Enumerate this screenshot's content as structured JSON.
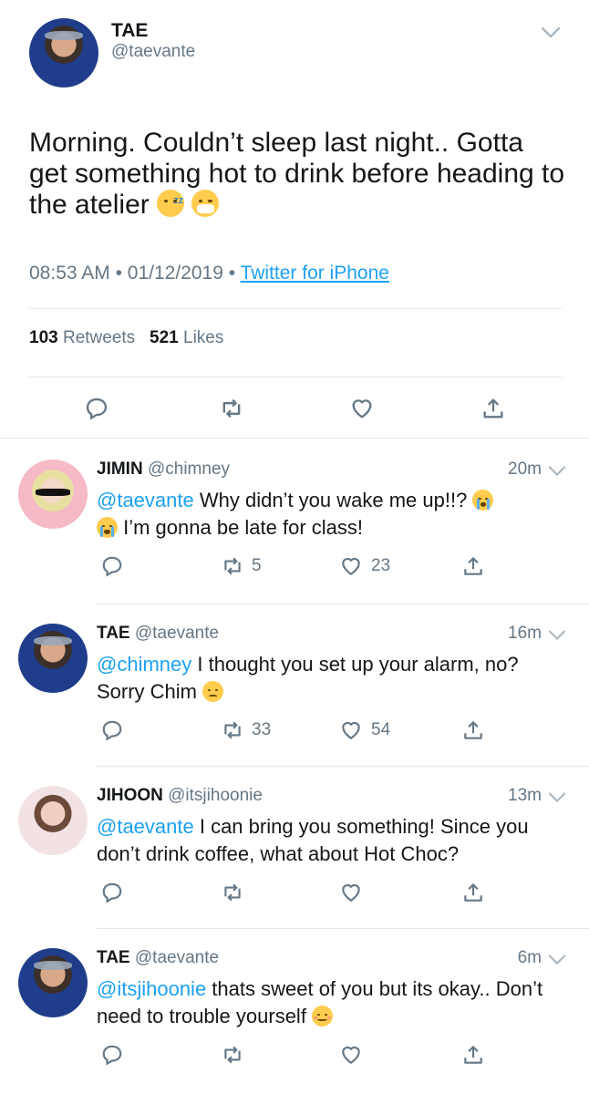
{
  "main_tweet": {
    "name": "TAE",
    "handle": "@taevante",
    "text": "Morning. Couldn’t sleep last night.. Gotta get something hot to drink before heading to the atelier",
    "emojis": [
      "sleeping-face-emoji",
      "mask-face-emoji"
    ],
    "time": "08:53 AM",
    "separator": "•",
    "date": "01/12/2019",
    "source": "Twitter for iPhone",
    "retweets_count": "103",
    "retweets_label": "Retweets",
    "likes_count": "521",
    "likes_label": "Likes"
  },
  "replies": [
    {
      "name": "JIMIN",
      "handle": "@chimney",
      "time": "20m",
      "mention": "@taevante",
      "text_a": " Why didn’t you wake me up!!? ",
      "text_b": " I’m gonna be late for class!",
      "retweets": "5",
      "likes": "23"
    },
    {
      "name": "TAE",
      "handle": "@taevante",
      "time": "16m",
      "mention": "@chimney",
      "text_a": " I thought you set up your alarm, no? Sorry Chim ",
      "retweets": "33",
      "likes": "54"
    },
    {
      "name": "JIHOON",
      "handle": "@itsjihoonie",
      "time": "13m",
      "mention": "@taevante",
      "text_a": " I can bring you something! Since you don’t drink coffee, what about Hot Choc?"
    },
    {
      "name": "TAE",
      "handle": "@taevante",
      "time": "6m",
      "mention": "@itsjihoonie",
      "text_a": " thats sweet of you but its okay.. Don’t need to trouble yourself "
    }
  ],
  "colors": {
    "accent": "#1da1f2",
    "secondary_text": "#657786",
    "divider": "#e1e8ed",
    "primary_text": "#14171a"
  }
}
